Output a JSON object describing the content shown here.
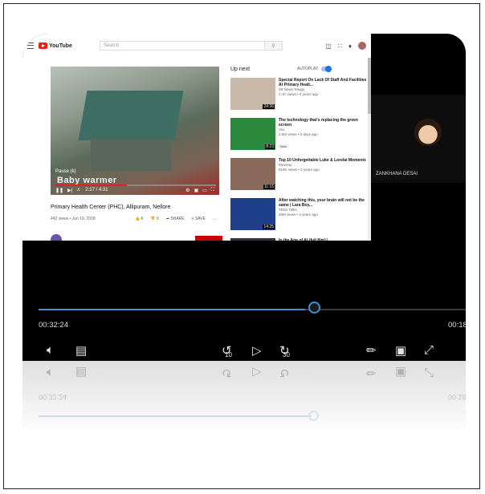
{
  "youtube": {
    "logo_text": "YouTube",
    "search_placeholder": "Search",
    "player": {
      "pause_label": "Pause (k)",
      "caption": "Baby warmer",
      "time": "2:17 / 4:31",
      "progress": 0.45
    },
    "video_title": "Primary Health Center (PHC), Allipuram, Nellore",
    "video_meta": "442 views • Jun 19, 2018",
    "actions": [
      "6",
      "0",
      "SHARE",
      "SAVE",
      "..."
    ],
    "up_next_label": "Up next",
    "autoplay_label": "AUTOPLAY",
    "recommendations": [
      {
        "title": "Special Report On Lack Of Staff And Facilities At Primary Healt...",
        "channel": "V6 News Telugu",
        "meta": "1.7K views • 4 years ago",
        "duration": "24:36",
        "badge": "",
        "color": "#c9b9a9"
      },
      {
        "title": "The technology that's replacing the green screen",
        "channel": "Vox",
        "meta": "2.5M views • 6 days ago",
        "duration": "8:23",
        "badge": "New",
        "color": "#2b8a3e"
      },
      {
        "title": "Top 10 Unforgettable Luke & Lorelai Moments",
        "channel": "Moviesp",
        "meta": "819K views • 2 years ago",
        "duration": "11:16",
        "badge": "",
        "color": "#8a6a5a"
      },
      {
        "title": "After watching this, your brain will not be the same | Lara Boy...",
        "channel": "TEDx Talks",
        "meta": "28M views • 4 years ago",
        "duration": "14:25",
        "badge": "",
        "color": "#1f3f8a"
      },
      {
        "title": "In the Age of AI (full film) |",
        "channel": "",
        "meta": "",
        "duration": "",
        "badge": "",
        "color": "#334"
      }
    ]
  },
  "participant": {
    "name": "ZANKHANA DESAI"
  },
  "playback": {
    "elapsed": "00:32:24",
    "remaining": "00:18:",
    "progress": 0.64
  },
  "controls": {
    "volume_icon": "speaker-icon",
    "captions_icon": "captions-icon",
    "rewind_seconds": "10",
    "forward_seconds": "30",
    "pen_icon": "pen-icon",
    "pip_icon": "picture-in-picture-icon",
    "fullscreen_icon": "expand-icon"
  },
  "colors": {
    "accent": "#3e8ed0",
    "youtube_red": "#e62117"
  }
}
